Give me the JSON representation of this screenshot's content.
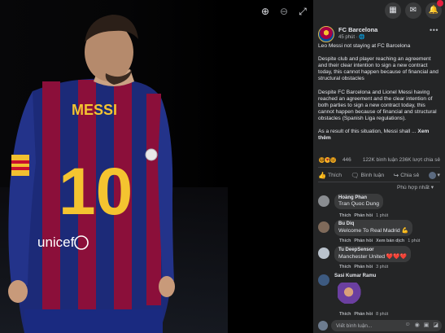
{
  "viewer": {
    "tools": [
      {
        "name": "zoom-in-icon",
        "glyph": "⊕"
      },
      {
        "name": "zoom-out-icon",
        "glyph": "⊖"
      },
      {
        "name": "fullscreen-icon",
        "glyph": "⤢"
      }
    ],
    "photo": {
      "jersey_name": "MESSI",
      "jersey_number": "10",
      "sponsor": "unicef"
    }
  },
  "topbar": {
    "icons": [
      "menu-grid-icon",
      "messenger-icon",
      "notifications-bell-icon"
    ]
  },
  "post": {
    "page_name": "FC Barcelona",
    "time": "45 phút",
    "audience_icon": "globe-icon",
    "paragraphs": [
      "Leo Messi not staying at FC Barcelona",
      "Despite club and player reaching an agreement and their clear intention to sign a new contract today, this cannot happen because of financial and structural obstacles",
      "Despite FC Barcelona and Lionel Messi having reached an agreement and the clear intention of both parties to sign a new contract today, this cannot happen because of financial and structural obstacles (Spanish Liga regulations)."
    ],
    "last_paragraph": "As a result of this situation, Messi shall ...",
    "see_more": "Xem thêm",
    "reaction_count": "446",
    "comment_count": "122K bình luận",
    "share_count": "236K lượt chia sẻ"
  },
  "actions": {
    "like": "Thích",
    "comment": "Bình luận",
    "share": "Chia sẻ"
  },
  "sort_label": "Phù hợp nhất",
  "comments": [
    {
      "name": "Hoàng Phan",
      "text": "Tran Quoc Dung",
      "like": "Thích",
      "reply": "Phản hồi",
      "translate": "",
      "time": "1 phút",
      "avatar": "#8a8d91"
    },
    {
      "name": "Bu Diq",
      "text": "Welcome To Real Madrid 💪",
      "like": "Thích",
      "reply": "Phản hồi",
      "translate": "Xem bản dịch",
      "time": "1 phút",
      "avatar": "#7f6a5a"
    },
    {
      "name": "Tu DeepSensor",
      "text": "Manchester United ❤️❤️❤️",
      "like": "Thích",
      "reply": "Phản hồi",
      "translate": "",
      "time": "3 phút",
      "avatar": "#b9c2cc"
    },
    {
      "name": "Sasi Kumar Ramu",
      "text": "",
      "like": "Thích",
      "reply": "Phản hồi",
      "translate": "",
      "time": "8 phút",
      "avatar": "#3d5a80"
    }
  ],
  "composer": {
    "placeholder": "Viết bình luận...",
    "icons": [
      "emoji-icon",
      "camera-icon",
      "gif-icon",
      "sticker-icon"
    ]
  }
}
